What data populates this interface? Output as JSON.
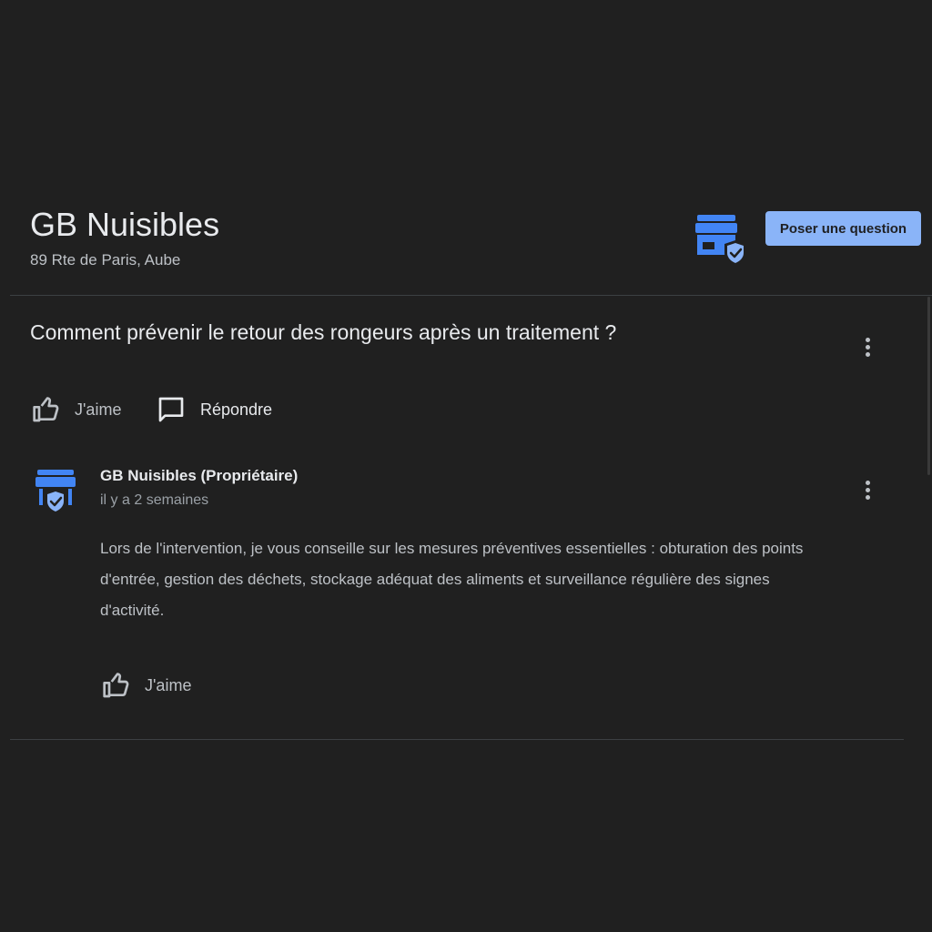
{
  "business": {
    "name": "GB Nuisibles",
    "address": "89 Rte de Paris, Aube",
    "ask_button_label": "Poser une question",
    "badge_icon": "verified-store-icon"
  },
  "question": {
    "text": "Comment prévenir le retour des rongeurs après un traitement ?",
    "like_label": "J'aime",
    "reply_label": "Répondre",
    "more_icon": "more-vertical-icon"
  },
  "answer": {
    "author": "GB Nuisibles (Propriétaire)",
    "time": "il y a 2 semaines",
    "body": "Lors de l'intervention, je vous conseille sur les mesures préventives essentielles : obturation des points d'entrée, gestion des déchets, stockage adéquat des aliments et surveillance régulière des signes d'activité.",
    "like_label": "J'aime",
    "avatar_icon": "verified-store-icon"
  },
  "colors": {
    "background": "#202020",
    "accent": "#8ab4f8",
    "store_blue": "#4285f4",
    "text_primary": "#e8eaed",
    "text_secondary": "#bdc1c6",
    "divider": "#3c4043"
  }
}
